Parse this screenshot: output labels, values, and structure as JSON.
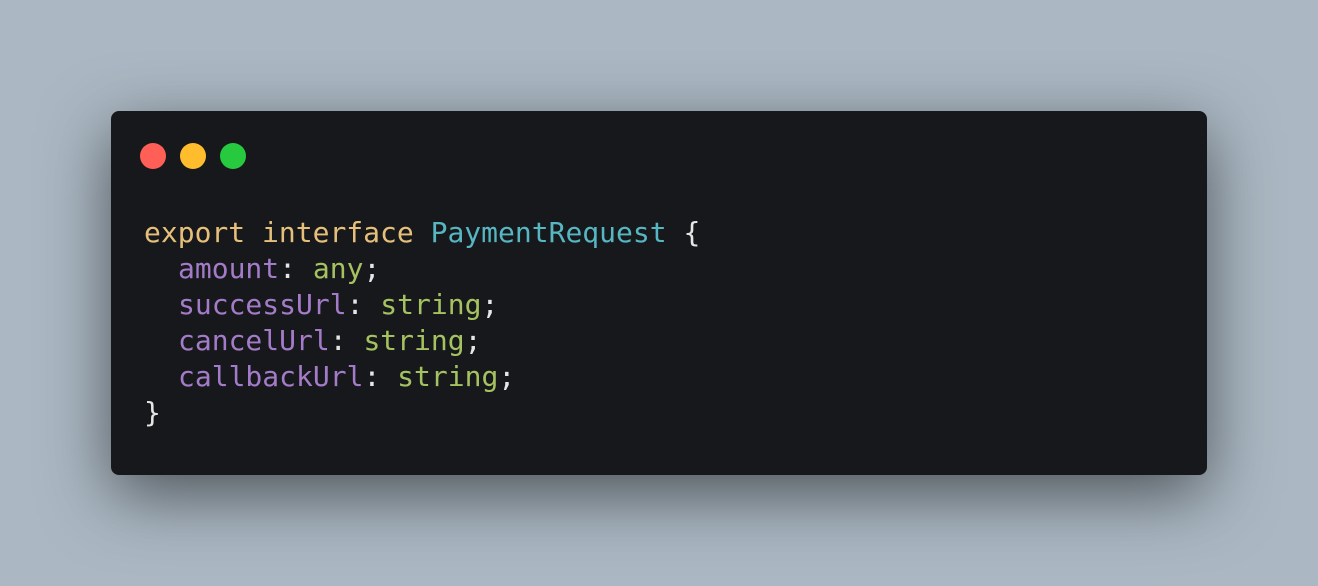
{
  "window": {
    "controls": [
      {
        "name": "close",
        "color": "#ff5f56"
      },
      {
        "name": "minimize",
        "color": "#ffbd2e"
      },
      {
        "name": "maximize",
        "color": "#27c93f"
      }
    ]
  },
  "code": {
    "line1": {
      "kw1": "export",
      "kw2": "interface",
      "type": "PaymentRequest",
      "brace": "{"
    },
    "fields": [
      {
        "name": "amount",
        "type": "any"
      },
      {
        "name": "successUrl",
        "type": "string"
      },
      {
        "name": "cancelUrl",
        "type": "string"
      },
      {
        "name": "callbackUrl",
        "type": "string"
      }
    ],
    "closing_brace": "}"
  },
  "colors": {
    "background": "#abb8c3",
    "window": "#17181b",
    "keyword": "#e6c07b",
    "type_name": "#56b6c2",
    "property": "#a47bc8",
    "property_type": "#a5c261",
    "punctuation": "#e6e6e6"
  }
}
